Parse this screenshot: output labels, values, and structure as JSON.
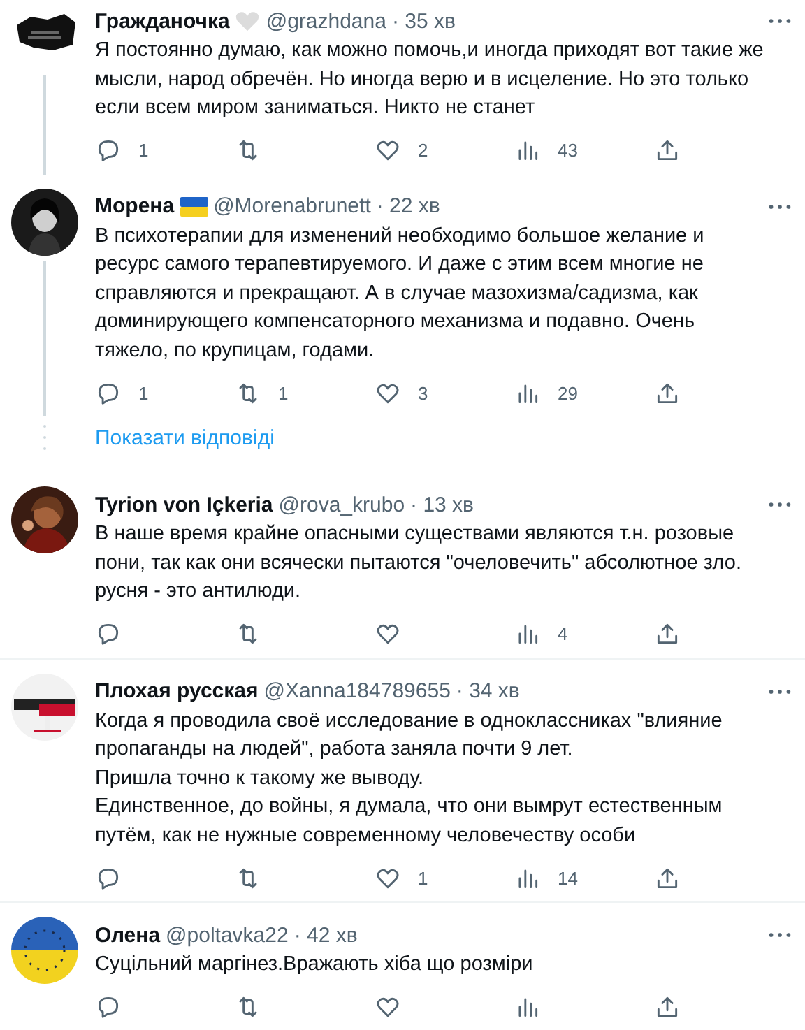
{
  "tweets": [
    {
      "name": "Гражданочка",
      "badge": {
        "kind": "heart"
      },
      "handle": "@grazhdana",
      "time": "· 35 хв",
      "paragraphs": [
        "Я постоянно думаю, как можно помочь,и иногда приходят вот такие же мысли, народ обречён. Но иногда верю и в исцеление. Но это только если всем миром заниматься. Никто не станет"
      ],
      "thread_line": true,
      "actions": {
        "replies": "1",
        "likes": "2",
        "views": "43"
      }
    },
    {
      "name": "Морена",
      "badge": {
        "kind": "flag"
      },
      "handle": "@Morenabrunett",
      "time": "· 22 хв",
      "paragraphs": [
        "В психотерапии для изменений необходимо большое желание и ресурс самого терапевтируемого. И даже с этим всем многие не справляются и прекращают. А в случае мазохизма/садизма, как доминирующего компенсаторного механизма и подавно. Очень тяжело, по крупицам, годами."
      ],
      "thread_line": true,
      "actions": {
        "replies": "1",
        "retweets": "1",
        "likes": "3",
        "views": "29"
      },
      "show_replies": "Показати відповіді"
    },
    {
      "name": "Tyrion von Içkeria",
      "handle": "@rova_krubo",
      "time": "· 13 хв",
      "paragraphs": [
        "В наше время крайне опасными существами являются т.н. розовые пони, так как они всячески пытаются \"очеловечить\" абсолютное зло. русня - это антилюди."
      ],
      "thread_line": false,
      "actions": {
        "views": "4"
      }
    },
    {
      "name": "Плохая русская",
      "handle": "@Xanna184789655",
      "time": "· 34 хв",
      "paragraphs": [
        "Когда я проводила своё исследование в одноклассниках \"влияние пропаганды на людей\", работа заняла почти 9 лет.",
        "Пришла точно к такому же выводу.",
        "Единственное, до войны, я думала, что они вымрут естественным путём, как не нужные современному человечеству особи"
      ],
      "thread_line": false,
      "actions": {
        "likes": "1",
        "views": "14"
      }
    },
    {
      "name": "Олена",
      "handle": "@poltavka22",
      "time": "· 42 хв",
      "paragraphs": [
        "Суцільний маргінез.Вражають хіба що розміри"
      ],
      "thread_line": false
    }
  ]
}
